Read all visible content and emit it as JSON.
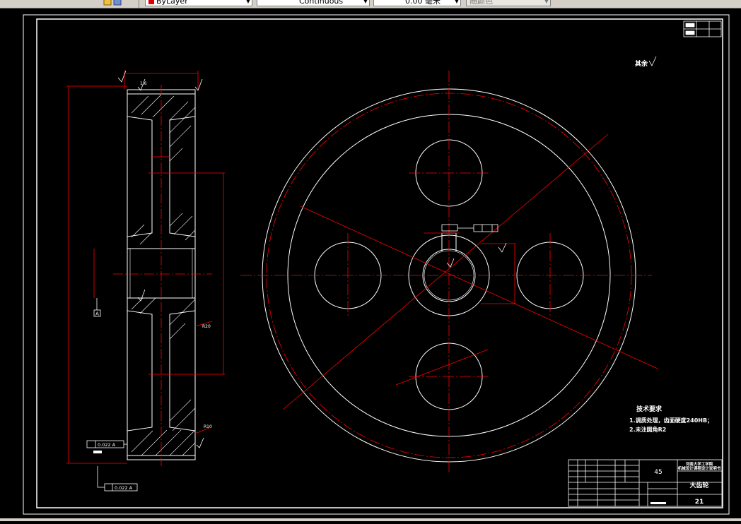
{
  "toolbar": {
    "layer_combo": "ByLayer",
    "linetype_combo": "Continuous",
    "lineweight_combo": "0.00 毫米",
    "plotstyle_combo": "随颜色"
  },
  "drawing": {
    "roughness_general": "其余",
    "tech_title": "技术要求",
    "tech_item_1": "1.调质处理，齿面硬度240HB；",
    "tech_item_2": "2.未注圆角R2",
    "material": "45",
    "part_name": "大齿轮",
    "school_line_1": "河南大学工学院",
    "school_line_2": "机械设计课程设计说明书",
    "sheet_number": "21",
    "datum_label": "A",
    "tolerance_1": "0.022 A",
    "tolerance_2": "0.022 A",
    "fillet_r20": "R20",
    "fillet_r10": "R10",
    "roughness_value": "1.6"
  },
  "colors": {
    "line_white": "#ffffff",
    "line_red": "#ff0000",
    "toolbar_bg": "#d4d0c8"
  }
}
